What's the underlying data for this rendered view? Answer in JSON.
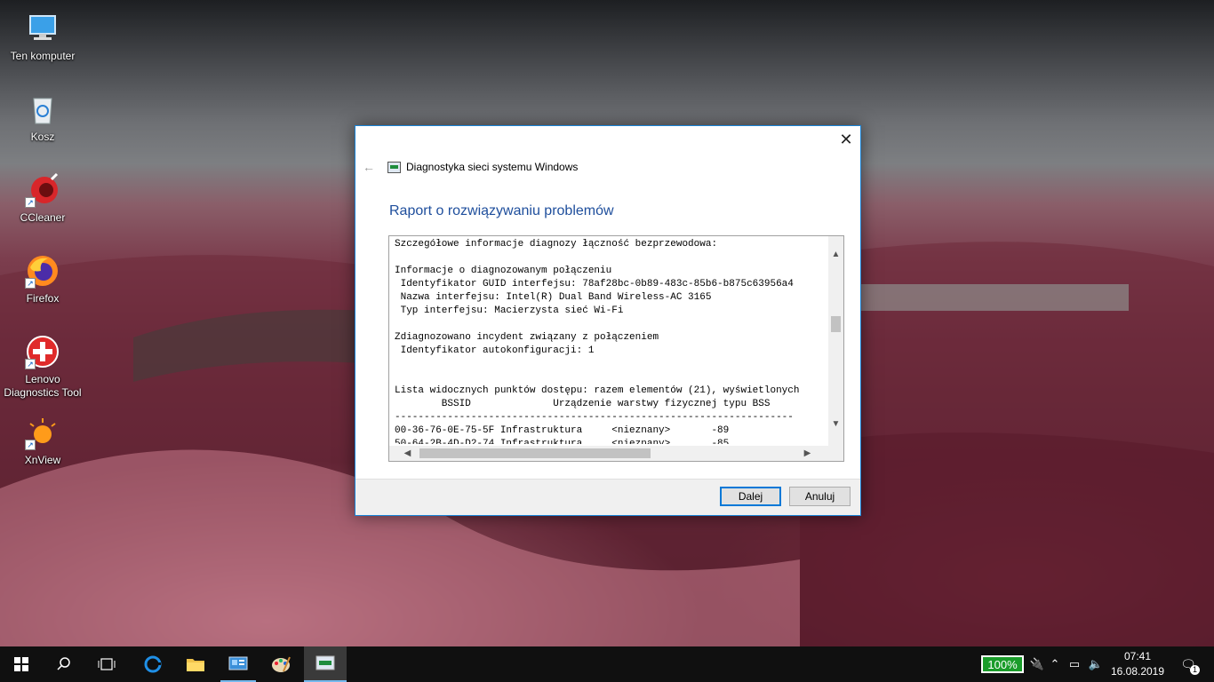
{
  "desktop": {
    "icons": [
      {
        "label": "Ten komputer",
        "icon": "computer-icon"
      },
      {
        "label": "Kosz",
        "icon": "recycle-bin-icon"
      },
      {
        "label": "CCleaner",
        "icon": "ccleaner-icon"
      },
      {
        "label": "Firefox",
        "icon": "firefox-icon"
      },
      {
        "label": "Lenovo Diagnostics Tool",
        "icon": "lenovo-diagnostics-icon"
      },
      {
        "label": "XnView",
        "icon": "xnview-icon"
      }
    ]
  },
  "dialog": {
    "window_title": "Diagnostyka sieci systemu Windows",
    "heading": "Raport o rozwiązywaniu problemów",
    "report_lines": [
      "Szczegółowe informacje diagnozy łączność bezprzewodowa:",
      "",
      "Informacje o diagnozowanym połączeniu",
      " Identyfikator GUID interfejsu: 78af28bc-0b89-483c-85b6-b875c63956a4",
      " Nazwa interfejsu: Intel(R) Dual Band Wireless-AC 3165",
      " Typ interfejsu: Macierzysta sieć Wi-Fi",
      "",
      "Zdiagnozowano incydent związany z połączeniem",
      " Identyfikator autokonfiguracji: 1",
      "",
      "",
      "Lista widocznych punktów dostępu: razem elementów (21), wyświetlonych",
      "        BSSID              Urządzenie warstwy fizycznej typu BSS",
      "--------------------------------------------------------------------",
      "00-36-76-0E-75-5F Infrastruktura     <nieznany>       -89",
      "50-64-2B-4D-D2-74 Infrastruktura     <nieznany>       -85"
    ],
    "next_label": "Dalej",
    "cancel_label": "Anuluj"
  },
  "taskbar": {
    "battery": "100%",
    "time": "07:41",
    "date": "16.08.2019",
    "notifications": "1"
  }
}
